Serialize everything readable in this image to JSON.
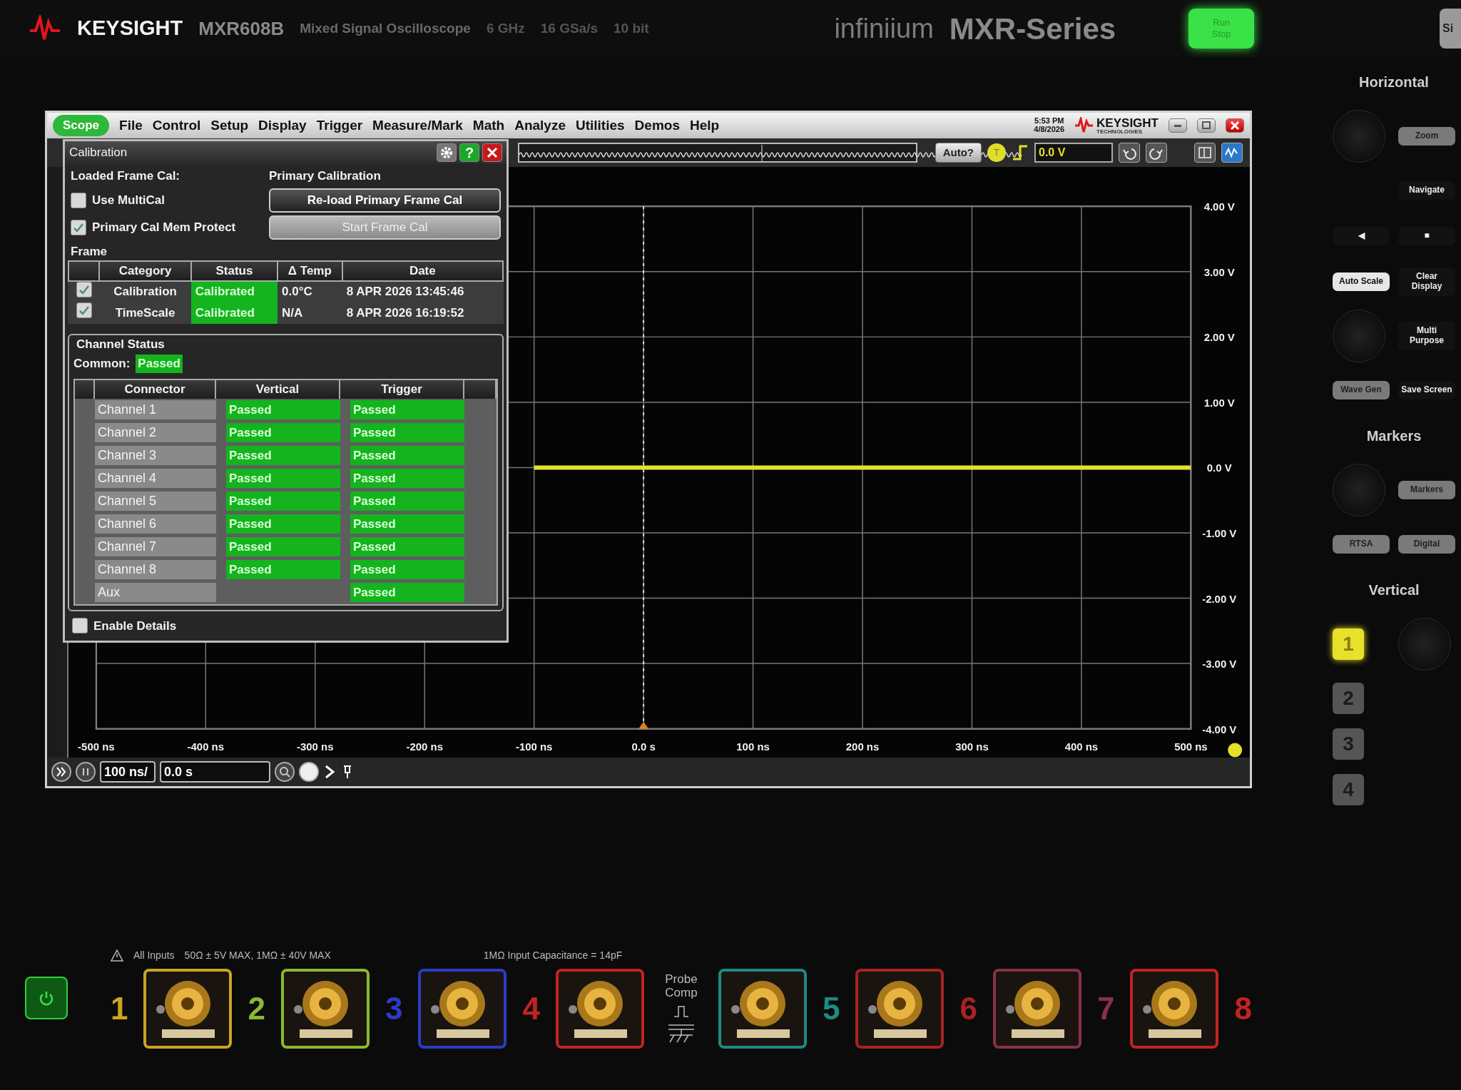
{
  "bezel": {
    "brand": "KEYSIGHT",
    "model": "MXR608B",
    "description": "Mixed Signal Oscilloscope",
    "specs": [
      "6 GHz",
      "16 GSa/s",
      "10 bit"
    ],
    "family": "infiniium",
    "series": "MXR-Series",
    "run_stop": {
      "top": "Run",
      "bottom": "Stop",
      "lit": true
    },
    "next_key": "Si"
  },
  "screen": {
    "scope_button": "Scope",
    "menu": [
      "File",
      "Control",
      "Setup",
      "Display",
      "Trigger",
      "Measure/Mark",
      "Math",
      "Analyze",
      "Utilities",
      "Demos",
      "Help"
    ],
    "clock": {
      "time": "5:53 PM",
      "date": "4/8/2026"
    },
    "logo": {
      "name": "KEYSIGHT",
      "subtitle": "TECHNOLOGIES"
    },
    "toolbar": {
      "auto_button": "Auto?",
      "trigger_badge": "T",
      "trigger_level": "0.0 V"
    },
    "plot": {
      "chart_data": {
        "type": "line",
        "x": [
          -100,
          500
        ],
        "grid": true,
        "ref_lines": [
          {
            "axis": "x",
            "value": 0
          }
        ],
        "series": [
          {
            "color": "#e6e02a",
            "values": [
              0,
              0
            ]
          }
        ],
        "xlim": [
          -500,
          500
        ],
        "ylim": [
          -4,
          4
        ],
        "xticks": [
          {
            "value": -500,
            "label": "-500 ns"
          },
          {
            "value": -400,
            "label": "-400 ns"
          },
          {
            "value": -300,
            "label": "-300 ns"
          },
          {
            "value": -200,
            "label": "-200 ns"
          },
          {
            "value": -100,
            "label": "-100 ns"
          },
          {
            "value": 0,
            "label": "0.0 s"
          },
          {
            "value": 100,
            "label": "100 ns"
          },
          {
            "value": 200,
            "label": "200 ns"
          },
          {
            "value": 300,
            "label": "300 ns"
          },
          {
            "value": 400,
            "label": "400 ns"
          },
          {
            "value": 500,
            "label": "500 ns"
          }
        ],
        "yticks": [
          {
            "value": 4,
            "label": "4.00 V"
          },
          {
            "value": 3,
            "label": "3.00 V"
          },
          {
            "value": 2,
            "label": "2.00 V"
          },
          {
            "value": 1,
            "label": "1.00 V"
          },
          {
            "value": 0,
            "label": "0.0 V"
          },
          {
            "value": -1,
            "label": "-1.00 V"
          },
          {
            "value": -2,
            "label": "-2.00 V"
          },
          {
            "value": -3,
            "label": "-3.00 V"
          },
          {
            "value": -4,
            "label": "-4.00 V"
          }
        ]
      }
    },
    "bottom_bar": {
      "timebase": "100 ns/",
      "delay": "0.0 s"
    }
  },
  "calibration_dialog": {
    "title": "Calibration",
    "help": "?",
    "loaded_label": "Loaded Frame Cal:",
    "primary_label": "Primary Calibration",
    "options": [
      {
        "label": "Use MultiCal",
        "checked": false
      },
      {
        "label": "Primary Cal Mem Protect",
        "checked": true
      }
    ],
    "buttons": [
      {
        "label": "Re-load Primary Frame Cal",
        "disabled": false
      },
      {
        "label": "Start Frame Cal",
        "disabled": true
      }
    ],
    "frame_label": "Frame",
    "frame_table": {
      "columns": [
        "Category",
        "Status",
        "Δ Temp",
        "Date"
      ],
      "rows": [
        {
          "checked": true,
          "category": "Calibration",
          "status": "Calibrated",
          "temp": "0.0°C",
          "date": "8 APR 2026 13:45:46"
        },
        {
          "checked": true,
          "category": "TimeScale",
          "status": "Calibrated",
          "temp": "N/A",
          "date": "8 APR 2026 16:19:52"
        }
      ]
    },
    "channel_status": {
      "title": "Channel Status",
      "common_label": "Common:",
      "common": "Passed",
      "columns": [
        "Connector",
        "Vertical",
        "Trigger"
      ],
      "rows": [
        {
          "connector": "Channel 1",
          "vertical": "Passed",
          "trigger": "Passed"
        },
        {
          "connector": "Channel 2",
          "vertical": "Passed",
          "trigger": "Passed"
        },
        {
          "connector": "Channel 3",
          "vertical": "Passed",
          "trigger": "Passed"
        },
        {
          "connector": "Channel 4",
          "vertical": "Passed",
          "trigger": "Passed"
        },
        {
          "connector": "Channel 5",
          "vertical": "Passed",
          "trigger": "Passed"
        },
        {
          "connector": "Channel 6",
          "vertical": "Passed",
          "trigger": "Passed"
        },
        {
          "connector": "Channel 7",
          "vertical": "Passed",
          "trigger": "Passed"
        },
        {
          "connector": "Channel 8",
          "vertical": "Passed",
          "trigger": "Passed"
        },
        {
          "connector": "Aux",
          "trigger": "Passed"
        }
      ]
    },
    "enable_details": {
      "label": "Enable Details",
      "checked": false
    }
  },
  "right_panel": {
    "rows": [
      [
        {
          "kind": "heading",
          "text": "Horizontal"
        }
      ],
      [
        {
          "kind": "knob"
        },
        {
          "kind": "grey",
          "text": "Zoom"
        }
      ],
      [
        {
          "kind": "blank"
        },
        {
          "kind": "dark",
          "text": "Navigate"
        }
      ],
      [
        {
          "kind": "dark",
          "text": "◀"
        },
        {
          "kind": "dark",
          "text": "■"
        }
      ],
      [
        {
          "kind": "light",
          "text": "Auto Scale"
        },
        {
          "kind": "dark",
          "text": "Clear Display"
        }
      ],
      [
        {
          "kind": "knob"
        },
        {
          "kind": "dark",
          "text": "Multi Purpose"
        }
      ],
      [
        {
          "kind": "grey",
          "text": "Wave Gen"
        },
        {
          "kind": "dark",
          "text": "Save Screen"
        }
      ],
      [
        {
          "kind": "heading",
          "text": "Markers"
        }
      ],
      [
        {
          "kind": "knob"
        },
        {
          "kind": "grey",
          "text": "Markers"
        }
      ],
      [
        {
          "kind": "grey",
          "text": "RTSA"
        },
        {
          "kind": "grey",
          "text": "Digital"
        }
      ],
      [
        {
          "kind": "heading",
          "text": "Vertical"
        }
      ],
      [
        {
          "kind": "channel",
          "text": "1",
          "lit": true
        },
        {
          "kind": "knob"
        }
      ],
      [
        {
          "kind": "channel",
          "text": "2",
          "lit": false
        }
      ],
      [
        {
          "kind": "channel",
          "text": "3",
          "lit": false
        }
      ],
      [
        {
          "kind": "channel",
          "text": "4",
          "lit": false
        }
      ]
    ]
  },
  "inputs": {
    "warning_label": "All Inputs",
    "warning": "50Ω ± 5V MAX,  1MΩ ± 40V MAX",
    "capacitance": "1MΩ Input Capacitance = 14pF",
    "probe_comp": "Probe Comp",
    "left": [
      {
        "number": "1",
        "color": "#c9a521"
      },
      {
        "number": "2",
        "color": "#8bb832"
      },
      {
        "number": "3",
        "color": "#2a3cc4"
      },
      {
        "number": "4",
        "color": "#c42222"
      }
    ],
    "right": [
      {
        "number": "5",
        "color": "#1f8a84"
      },
      {
        "number": "6",
        "color": "#a82222"
      },
      {
        "number": "7",
        "color": "#8a3048"
      },
      {
        "number": "8",
        "color": "#c42222"
      }
    ]
  }
}
